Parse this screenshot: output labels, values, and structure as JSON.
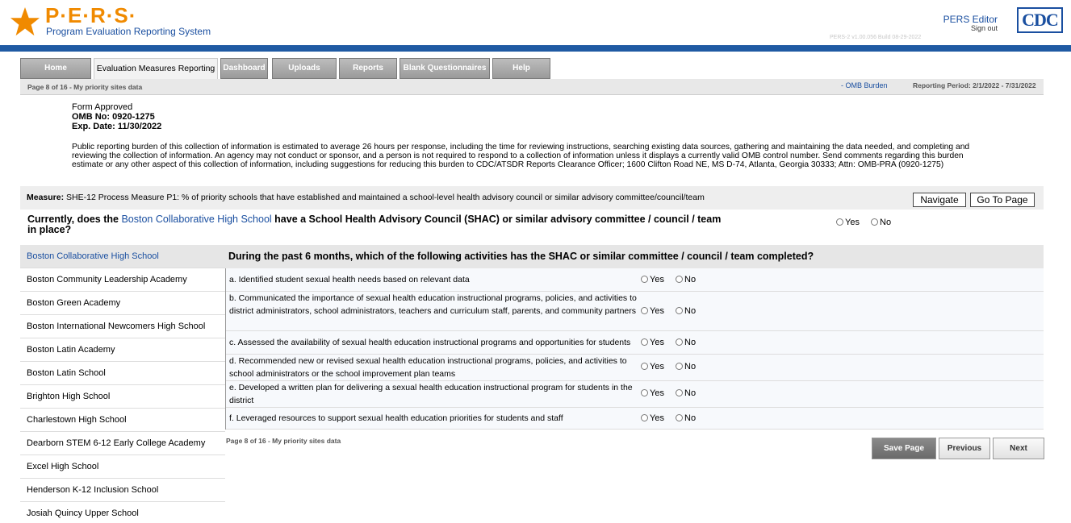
{
  "header": {
    "logo_title": "P·E·R·S·",
    "logo_subtitle": "Program Evaluation Reporting System",
    "editor_label": "PERS Editor",
    "signout_label": "Sign out",
    "version_text": "PERS-2 v1.00.056   Build 08-29-2022",
    "cdc_label": "CDC"
  },
  "tabs": [
    {
      "label": "Home",
      "active": false
    },
    {
      "label": "Evaluation Measures Reporting",
      "active": true
    },
    {
      "label": "Dashboard",
      "active": false
    },
    {
      "label": "Uploads",
      "active": false
    },
    {
      "label": "Reports",
      "active": false
    },
    {
      "label": "Blank Questionnaires",
      "active": false
    },
    {
      "label": "Help",
      "active": false
    }
  ],
  "subbar": {
    "page_info": "Page 8 of 16 - My priority sites data",
    "omb_link": "- OMB Burden",
    "reporting_period": "Reporting Period: 2/1/2022 - 7/31/2022"
  },
  "form": {
    "approved": "Form Approved",
    "omb_no": "OMB No: 0920-1275",
    "exp_date": "Exp. Date: 11/30/2022",
    "burden": "Public reporting burden of this collection of information is estimated to average 26 hours per response, including the time for reviewing instructions, searching existing data sources, gathering and maintaining the data needed, and completing and reviewing the collection of information. An agency may not conduct or sponsor, and a person is not required to respond to a collection of information unless it displays a currently valid OMB control number. Send comments regarding this burden estimate or any other aspect of this collection of information, including suggestions for reducing this burden to CDC/ATSDR Reports Clearance Officer; 1600 Clifton Road NE, MS D-74, Atlanta, Georgia 30333; Attn: OMB-PRA (0920-1275)"
  },
  "measure": {
    "label": "Measure:",
    "text": " SHE-12 Process Measure P1: % of priority schools that have established and maintained a school-level health advisory council or similar advisory committee/council/team",
    "navigate_label": "Navigate",
    "goto_label": "Go To Page"
  },
  "question": {
    "prefix": "Currently, does the ",
    "school": "Boston Collaborative High School",
    "suffix": " have a School Health Advisory Council (SHAC) or similar advisory committee / council / team in place?",
    "yes": "Yes",
    "no": "No"
  },
  "schools": [
    "Boston Collaborative High School",
    "Boston Community Leadership Academy",
    "Boston Green Academy",
    "Boston International Newcomers High School",
    "Boston Latin Academy",
    "Boston Latin School",
    "Brighton High School",
    "Charlestown High School",
    "Dearborn STEM 6-12 Early College Academy",
    "Excel High School",
    "Henderson K-12 Inclusion School",
    "Josiah Quincy Upper School"
  ],
  "activities_header": "During the past 6 months, which of the following activities has the SHAC or similar committee / council / team completed?",
  "activities": [
    "a. Identified student sexual health needs based on relevant data",
    "b. Communicated the importance of sexual health education instructional programs, policies, and activities to district administrators, school administrators, teachers and curriculum staff, parents, and community partners",
    "c. Assessed the availability of sexual health education instructional programs and opportunities for students",
    "d. Recommended new or revised sexual health education instructional programs, policies, and activities to school administrators or the school improvement plan teams",
    "e. Developed a written plan for delivering a sexual health education instructional program for students in the district",
    "f. Leveraged resources to support sexual health education priorities for students and staff"
  ],
  "yes_label": "Yes",
  "no_label": "No",
  "footer": {
    "page_info": "Page 8 of 16 - My priority sites data",
    "save_label": "Save Page",
    "previous_label": "Previous",
    "next_label": "Next"
  }
}
